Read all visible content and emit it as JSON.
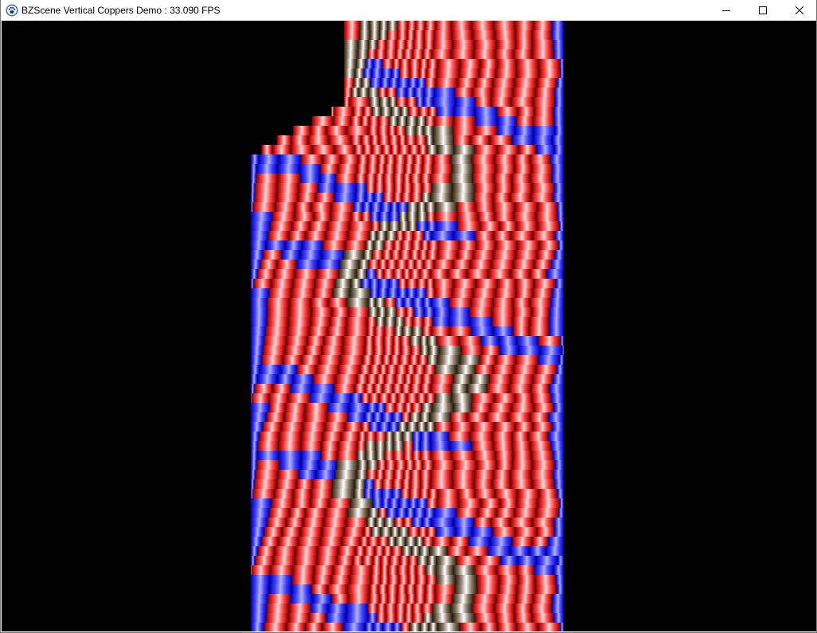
{
  "window": {
    "title": "BZScene Vertical Coppers Demo : 33.090 FPS",
    "app_icon": "paw-icon",
    "controls": [
      "minimize-icon",
      "maximize-icon",
      "close-icon"
    ]
  },
  "scene": {
    "background": "#000000",
    "palettes": {
      "red": [
        "#7a0000",
        "#ff3a3a",
        "#ffd6d6",
        "#ff3a3a",
        "#7a0000"
      ],
      "blue": [
        "#0000aa",
        "#3c3cff",
        "#b0b0ff",
        "#3c3cff",
        "#0000aa"
      ],
      "cream": [
        "#2a1e10",
        "#8a7a66",
        "#ffffff",
        "#8a7a66",
        "#2a1e10"
      ]
    }
  }
}
